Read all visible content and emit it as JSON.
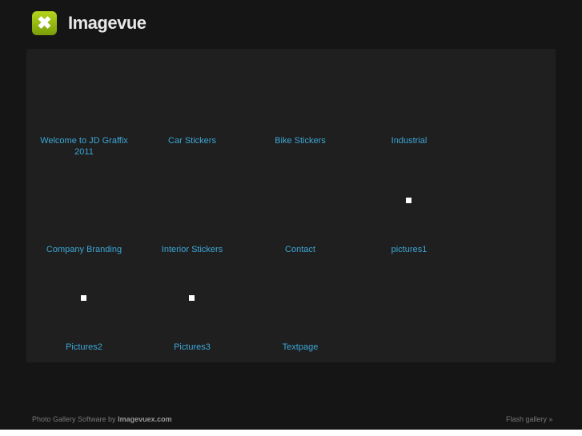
{
  "header": {
    "brand": "Imagevue",
    "logo_icon": "x-icon"
  },
  "gallery": {
    "items": [
      {
        "label": "Welcome to JD Graffix 2011",
        "has_thumb": false
      },
      {
        "label": "Car Stickers",
        "has_thumb": false
      },
      {
        "label": "Bike Stickers",
        "has_thumb": false
      },
      {
        "label": "Industrial",
        "has_thumb": false
      },
      {
        "label": "Company Branding",
        "has_thumb": false
      },
      {
        "label": "Interior Stickers",
        "has_thumb": false
      },
      {
        "label": "Contact",
        "has_thumb": false
      },
      {
        "label": "pictures1",
        "has_thumb": true
      },
      {
        "label": "Pictures2",
        "has_thumb": true
      },
      {
        "label": "Pictures3",
        "has_thumb": true
      },
      {
        "label": "Textpage",
        "has_thumb": false
      }
    ]
  },
  "footer": {
    "credit_prefix": "Photo Gallery Software by",
    "credit_link": "Imagevuex.com",
    "flash_link": "Flash gallery »"
  }
}
